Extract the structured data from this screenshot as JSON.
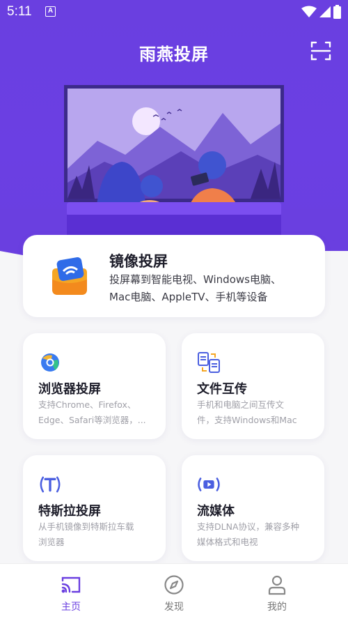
{
  "status_bar": {
    "time": "5:11",
    "notif_letter": "A"
  },
  "header": {
    "title": "雨燕投屏",
    "scan_icon": "scan-icon"
  },
  "mirror_card": {
    "title": "镜像投屏",
    "desc_line1": "投屏幕到智能电视、Windows电脑、",
    "desc_line2": "Mac电脑、AppleTV、手机等设备",
    "icon": "cast-screen-icon"
  },
  "features": [
    {
      "title": "浏览器投屏",
      "desc_line1": "支持Chrome、Firefox、",
      "desc_line2": "Edge、Safari等浏览器，...",
      "icon": "browser-icon"
    },
    {
      "title": "文件互传",
      "desc_line1": "手机和电脑之间互传文",
      "desc_line2": "件，支持Windows和Mac",
      "icon": "file-transfer-icon"
    },
    {
      "title": "特斯拉投屏",
      "desc_line1": "从手机镜像到特斯拉车载",
      "desc_line2": "浏览器",
      "icon": "tesla-icon"
    },
    {
      "title": "流媒体",
      "desc_line1": "支持DLNA协议，兼容多种",
      "desc_line2": "媒体格式和电视",
      "icon": "streaming-icon"
    }
  ],
  "bottom_nav": [
    {
      "label": "主页",
      "icon": "cast-icon",
      "active": true
    },
    {
      "label": "发现",
      "icon": "compass-icon",
      "active": false
    },
    {
      "label": "我的",
      "icon": "user-icon",
      "active": false
    }
  ],
  "colors": {
    "primary": "#6a3fe0",
    "accent_orange": "#f5a623",
    "text_dark": "#1d1d2a",
    "text_gray": "#a0a0a8"
  }
}
